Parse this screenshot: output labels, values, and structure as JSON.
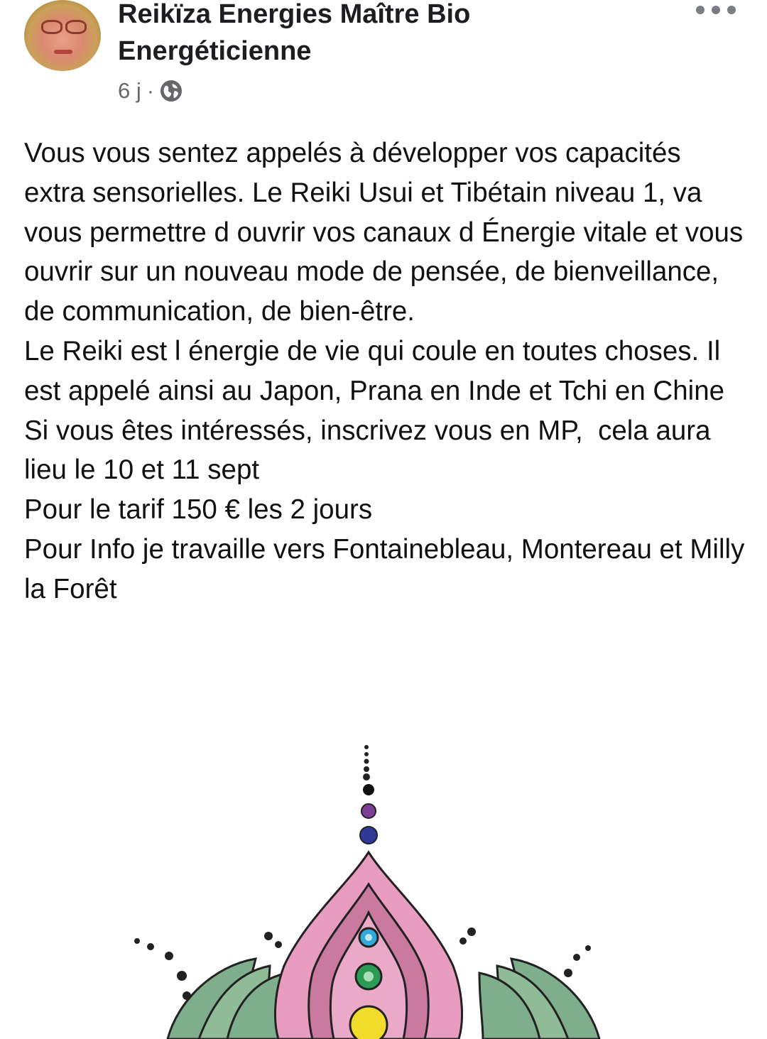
{
  "post": {
    "author": "Reikïza Energies Maître Bio Energéticienne",
    "timestamp": "6 j",
    "separator": "·",
    "audience_icon": "globe-icon",
    "more_icon": "more-horizontal-icon",
    "text": "Vous vous sentez appelés à développer vos capacités extra sensorielles. Le Reiki Usui et Tibétain niveau 1, va vous permettre d ouvrir vos canaux d Énergie vitale et vous ouvrir sur un nouveau mode de pensée, de bienveillance, de communication, de bien-être.\nLe Reiki est l énergie de vie qui coule en toutes choses. Il est appelé ainsi au Japon, Prana en Inde et Tchi en Chine\nSi vous êtes intéressés, inscrivez vous en MP,  cela aura lieu le 10 et 11 sept\nPour le tarif 150 € les 2 jours\nPour Info je travaille vers Fontainebleau, Montereau et Milly la Forêt"
  },
  "colors": {
    "text": "#111111",
    "meta": "#65676b",
    "lotus_pink": "#e79cc0",
    "lotus_leaf": "#7fae8c"
  }
}
